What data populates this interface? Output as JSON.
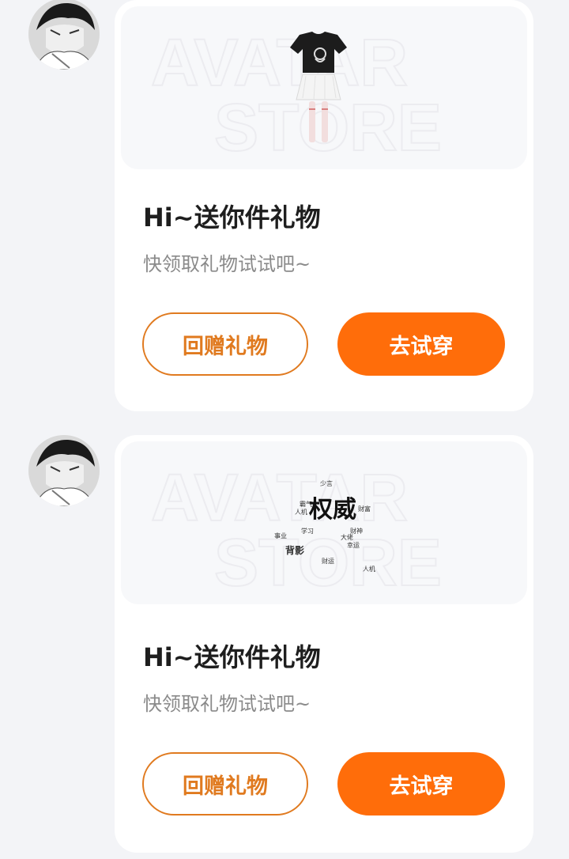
{
  "messages": [
    {
      "title": "Hi~送你件礼物",
      "subtitle": "快领取礼物试试吧~",
      "return_gift_label": "回赠礼物",
      "try_on_label": "去试穿",
      "item_icon": "tshirt-skirt-outfit-icon",
      "watermark_text": [
        "AVATAR",
        "STORE"
      ]
    },
    {
      "title": "Hi~送你件礼物",
      "subtitle": "快领取礼物试试吧~",
      "return_gift_label": "回赠礼物",
      "try_on_label": "去试穿",
      "item_icon": "calligraphy-sticker-icon",
      "item_text": {
        "main": "权威",
        "small": [
          "少言",
          "人机",
          "财富",
          "霸气",
          "事业",
          "财神",
          "幸运",
          "背影",
          "学习",
          "大佬",
          "财运",
          "人机"
        ]
      },
      "watermark_text": [
        "AVATAR",
        "STORE"
      ]
    }
  ],
  "colors": {
    "accent": "#ff6d0a",
    "outline": "#e07a1f",
    "background": "#f3f4f7",
    "card": "#ffffff"
  }
}
